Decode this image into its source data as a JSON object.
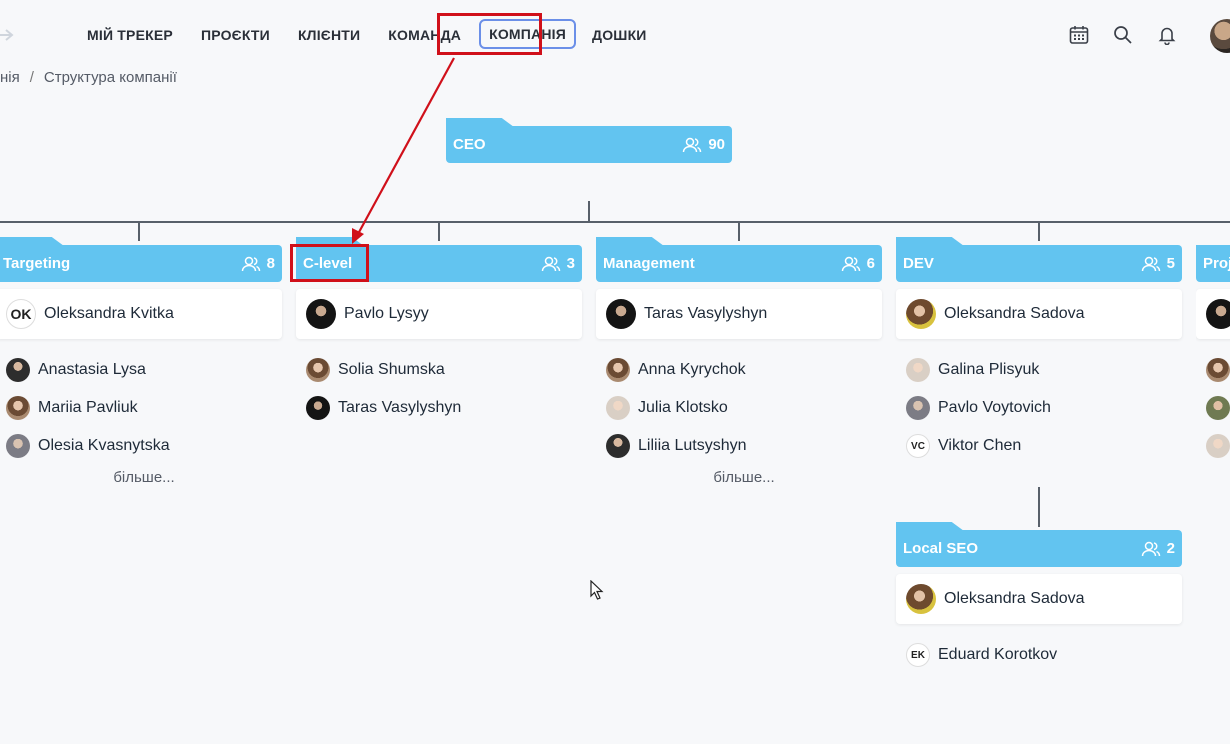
{
  "nav": {
    "items": [
      {
        "label": "МІЙ ТРЕКЕР"
      },
      {
        "label": "ПРОЄКТИ"
      },
      {
        "label": "КЛІЄНТИ"
      },
      {
        "label": "КОМАНДА"
      },
      {
        "label": "КОМПАНІЯ"
      },
      {
        "label": "ДОШКИ"
      }
    ],
    "active": "КОМПАНІЯ"
  },
  "toolbar_icons": [
    "calendar-icon",
    "search-icon",
    "bell-icon",
    "user-avatar"
  ],
  "breadcrumb": {
    "parent": "нія",
    "separator": "/",
    "current": "Структура компанії"
  },
  "root": {
    "name": "CEO",
    "count": "90"
  },
  "departments": [
    {
      "name": "Targeting",
      "count": "8",
      "head": {
        "name": "Oleksandra Kvitka",
        "initials": "OK"
      },
      "members": [
        {
          "name": "Anastasia Lysa"
        },
        {
          "name": "Mariia Pavliuk"
        },
        {
          "name": "Olesia Kvasnytska"
        }
      ],
      "more": "більше..."
    },
    {
      "name": "C-level",
      "count": "3",
      "head": {
        "name": "Pavlo Lysyy"
      },
      "members": [
        {
          "name": "Solia Shumska"
        },
        {
          "name": "Taras Vasylyshyn"
        }
      ]
    },
    {
      "name": "Management",
      "count": "6",
      "head": {
        "name": "Taras Vasylyshyn"
      },
      "members": [
        {
          "name": "Anna Kyrychok"
        },
        {
          "name": "Julia Klotsko"
        },
        {
          "name": "Liliia Lutsyshyn"
        }
      ],
      "more": "більше..."
    },
    {
      "name": "DEV",
      "count": "5",
      "head": {
        "name": "Oleksandra Sadova"
      },
      "members": [
        {
          "name": "Galina Plisyuk"
        },
        {
          "name": "Pavlo Voytovich"
        },
        {
          "name": "Viktor Chen",
          "initials": "VC"
        }
      ]
    },
    {
      "name": "Proj",
      "count": ""
    }
  ],
  "subdepartment": {
    "name": "Local SEO",
    "count": "2",
    "head": {
      "name": "Oleksandra Sadova"
    },
    "members": [
      {
        "name": "Eduard Korotkov",
        "initials": "EK"
      }
    ]
  },
  "colors": {
    "accent": "#62c4f0",
    "highlight": "#d0101a",
    "active_nav_border": "#6b8fe8"
  }
}
